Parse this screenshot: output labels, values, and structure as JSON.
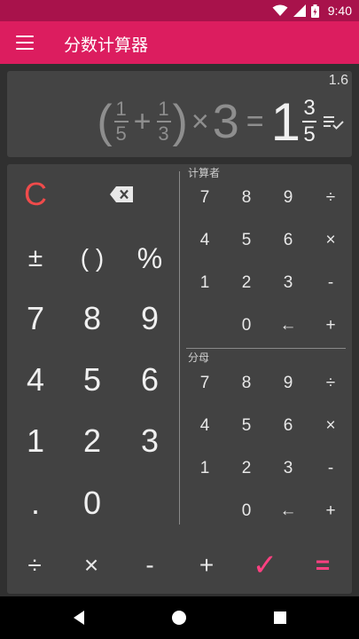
{
  "status_bar": {
    "time": "9:40"
  },
  "app_bar": {
    "title": "分数计算器"
  },
  "display": {
    "decimal_result": "1.6",
    "expression": {
      "open_paren": "(",
      "frac1": {
        "num": "1",
        "den": "5"
      },
      "plus": "+",
      "frac2": {
        "num": "1",
        "den": "3"
      },
      "close_paren": ")",
      "times": "×",
      "multiplier": "3",
      "equals": "=",
      "result_whole": "1",
      "result_frac": {
        "num": "3",
        "den": "5"
      }
    }
  },
  "left_keys": {
    "clear": "C",
    "plus_minus": "±",
    "parens": "( )",
    "percent": "%",
    "digits": [
      "7",
      "8",
      "9",
      "4",
      "5",
      "6",
      "1",
      "2",
      "3"
    ],
    "dot": ".",
    "zero": "0"
  },
  "numerator_pad": {
    "label": "计算者",
    "keys": [
      "7",
      "8",
      "9",
      "÷",
      "4",
      "5",
      "6",
      "×",
      "1",
      "2",
      "3",
      "-",
      "0",
      "←",
      "+"
    ]
  },
  "denominator_pad": {
    "label": "分母",
    "keys": [
      "7",
      "8",
      "9",
      "÷",
      "4",
      "5",
      "6",
      "×",
      "1",
      "2",
      "3",
      "-",
      "0",
      "←",
      "+"
    ]
  },
  "bottom_row": {
    "divide": "÷",
    "multiply": "×",
    "minus": "-",
    "plus": "+",
    "check": "✓",
    "equals": "="
  },
  "colors": {
    "accent": "#dc1d5f",
    "status_bar": "#a8124b",
    "clear": "#f04b4b",
    "check": "#ff4081",
    "equals": "#ff4081"
  }
}
